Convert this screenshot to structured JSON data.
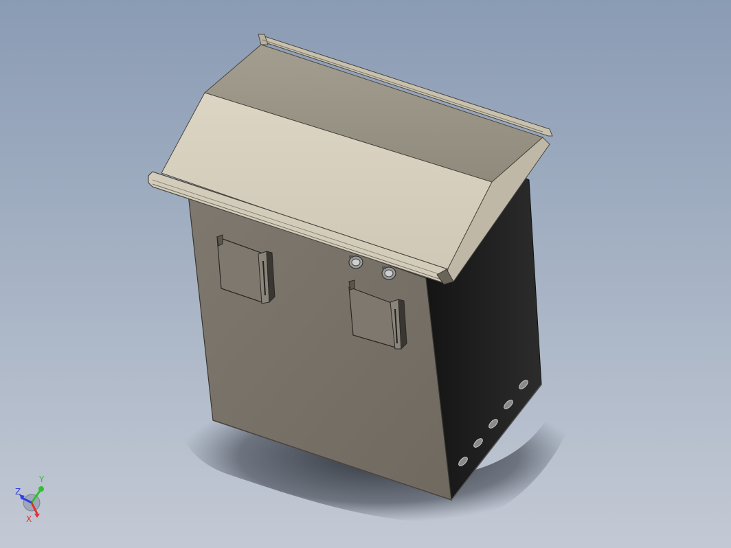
{
  "viewport": {
    "background_top": "#8a9bb4",
    "background_bottom": "#c3c9d4"
  },
  "model": {
    "front_color": "#78726a",
    "side_color": "#1e1e1e",
    "roof_light": "#d6cfbe",
    "roof_dark": "#9a9585"
  },
  "triad": {
    "x_label": "X",
    "y_label": "Y",
    "z_label": "Z",
    "x_color": "#e03030",
    "y_color": "#30c030",
    "z_color": "#3040e0"
  }
}
